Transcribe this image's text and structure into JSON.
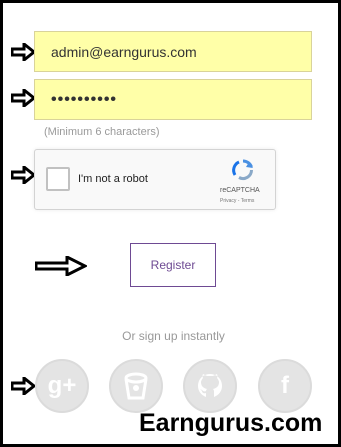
{
  "form": {
    "email_value": "admin@earngurus.com",
    "password_value": "••••••••••",
    "password_hint": "(Minimum 6 characters)",
    "captcha_label": "I'm not a robot",
    "captcha_brand": "reCAPTCHA",
    "captcha_links": "Privacy - Terms",
    "register_label": "Register"
  },
  "social": {
    "heading": "Or sign up instantly",
    "google_glyph": "g+",
    "facebook_glyph": "f",
    "icons": [
      "google-plus-icon",
      "bitbucket-icon",
      "github-icon",
      "facebook-icon"
    ]
  },
  "watermark": "Earngurus.com",
  "colors": {
    "field_background": "#ffffa8",
    "button_accent": "#6e4a93",
    "social_icon": "#e4e4e4"
  }
}
